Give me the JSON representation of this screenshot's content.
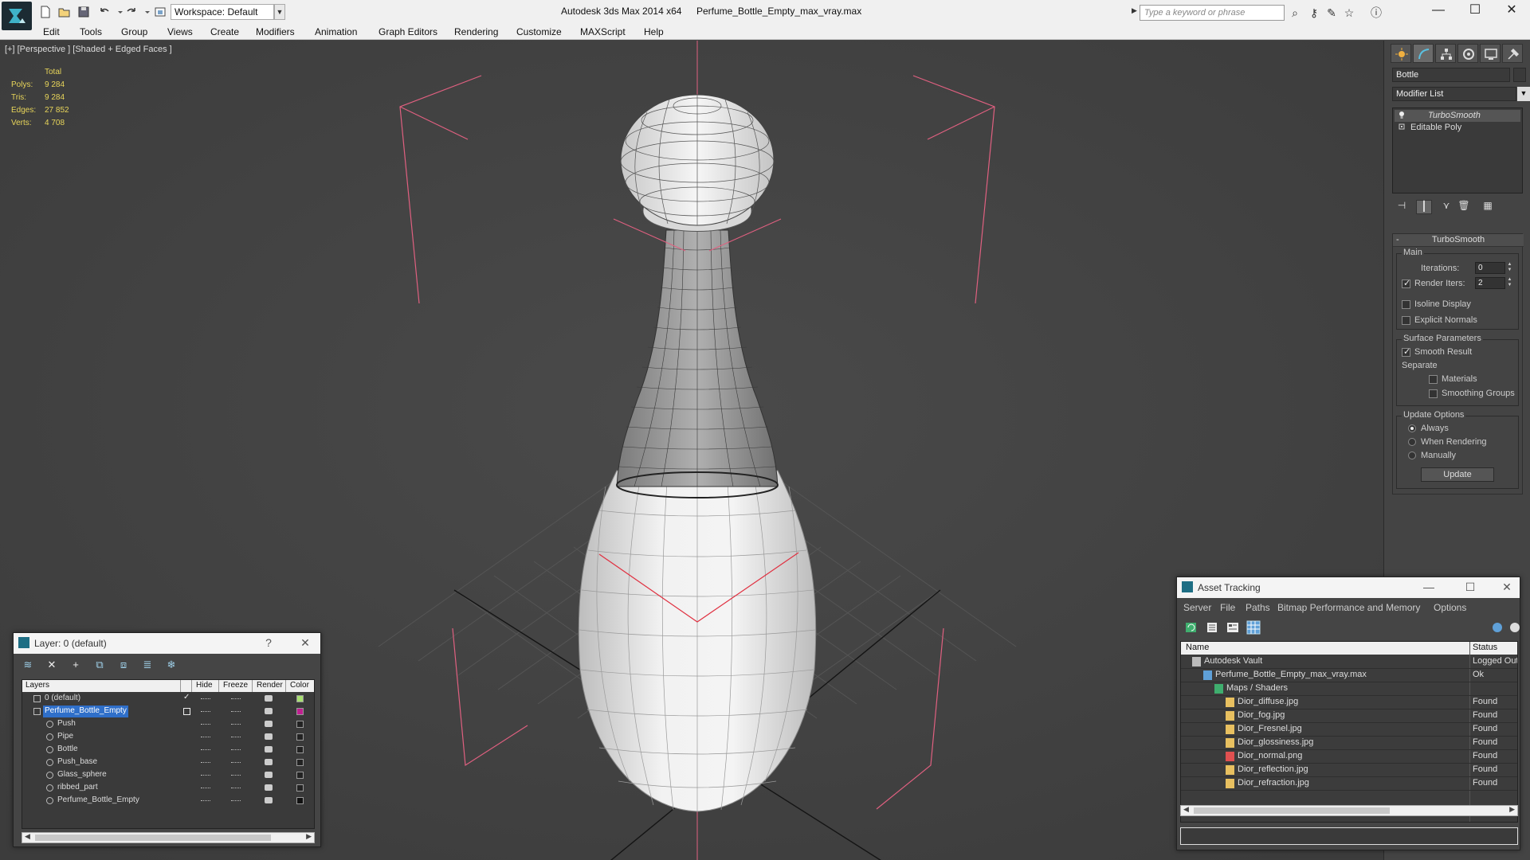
{
  "titlebar": {
    "workspace": "Workspace: Default",
    "app_title": "Autodesk 3ds Max 2014 x64",
    "file_title": "Perfume_Bottle_Empty_max_vray.max",
    "search_placeholder": "Type a keyword or phrase"
  },
  "menu": [
    "Edit",
    "Tools",
    "Group",
    "Views",
    "Create",
    "Modifiers",
    "Animation",
    "Graph Editors",
    "Rendering",
    "Customize",
    "MAXScript",
    "Help"
  ],
  "viewport": {
    "label": "[+] [Perspective ] [Shaded + Edged Faces ]",
    "stats": {
      "header": "Total",
      "rows": [
        {
          "label": "Polys:",
          "value": "9 284"
        },
        {
          "label": "Tris:",
          "value": "9 284"
        },
        {
          "label": "Edges:",
          "value": "27 852"
        },
        {
          "label": "Verts:",
          "value": "4 708"
        }
      ]
    }
  },
  "command_panel": {
    "object_name": "Bottle",
    "modifier_list": "Modifier List",
    "stack": [
      "TurboSmooth",
      "Editable Poly"
    ],
    "rollout_title": "TurboSmooth",
    "main_group": "Main",
    "iterations_label": "Iterations:",
    "iterations_value": "0",
    "render_iters_label": "Render Iters:",
    "render_iters_value": "2",
    "isoline_label": "Isoline Display",
    "explicit_normals_label": "Explicit Normals",
    "surface_group": "Surface Parameters",
    "smooth_result_label": "Smooth Result",
    "separate_label": "Separate",
    "materials_label": "Materials",
    "smoothing_groups_label": "Smoothing Groups",
    "update_group": "Update Options",
    "update_always": "Always",
    "update_when_rendering": "When Rendering",
    "update_manually": "Manually",
    "update_button": "Update"
  },
  "layer_window": {
    "title": "Layer: 0 (default)",
    "help": "?",
    "columns": [
      "Layers",
      "Hide",
      "Freeze",
      "Render",
      "Color"
    ],
    "rows": [
      {
        "name": "0 (default)",
        "indent": 0,
        "color": "#a8e070",
        "selected": false,
        "active": true
      },
      {
        "name": "Perfume_Bottle_Empty",
        "indent": 0,
        "color": "#c02090",
        "selected": true,
        "active": false
      },
      {
        "name": "Push",
        "indent": 1,
        "color": "#222222",
        "selected": false,
        "active": false
      },
      {
        "name": "Pipe",
        "indent": 1,
        "color": "#222222",
        "selected": false,
        "active": false
      },
      {
        "name": "Bottle",
        "indent": 1,
        "color": "#222222",
        "selected": false,
        "active": false
      },
      {
        "name": "Push_base",
        "indent": 1,
        "color": "#222222",
        "selected": false,
        "active": false
      },
      {
        "name": "Glass_sphere",
        "indent": 1,
        "color": "#222222",
        "selected": false,
        "active": false
      },
      {
        "name": "ribbed_part",
        "indent": 1,
        "color": "#222222",
        "selected": false,
        "active": false
      },
      {
        "name": "Perfume_Bottle_Empty",
        "indent": 1,
        "color": "#111111",
        "selected": false,
        "active": false
      }
    ]
  },
  "asset_window": {
    "title": "Asset Tracking",
    "menu": [
      "Server",
      "File",
      "Paths",
      "Bitmap Performance and Memory",
      "Options"
    ],
    "columns": [
      "Name",
      "Status"
    ],
    "rows": [
      {
        "name": "Autodesk Vault",
        "indent": 0,
        "status": "Logged Out",
        "icon": "vault"
      },
      {
        "name": "Perfume_Bottle_Empty_max_vray.max",
        "indent": 1,
        "status": "Ok",
        "icon": "max"
      },
      {
        "name": "Maps / Shaders",
        "indent": 2,
        "status": "",
        "icon": "maps"
      },
      {
        "name": "Dior_diffuse.jpg",
        "indent": 3,
        "status": "Found",
        "icon": "jpg"
      },
      {
        "name": "Dior_fog.jpg",
        "indent": 3,
        "status": "Found",
        "icon": "jpg"
      },
      {
        "name": "Dior_Fresnel.jpg",
        "indent": 3,
        "status": "Found",
        "icon": "jpg"
      },
      {
        "name": "Dior_glossiness.jpg",
        "indent": 3,
        "status": "Found",
        "icon": "jpg"
      },
      {
        "name": "Dior_normal.png",
        "indent": 3,
        "status": "Found",
        "icon": "png"
      },
      {
        "name": "Dior_reflection.jpg",
        "indent": 3,
        "status": "Found",
        "icon": "jpg"
      },
      {
        "name": "Dior_refraction.jpg",
        "indent": 3,
        "status": "Found",
        "icon": "jpg"
      }
    ]
  },
  "colors": {
    "selection": "#2f6fc9",
    "stats_yellow": "#e8d55a",
    "bracket_pink": "#e06080",
    "axis_red": "#e03040"
  }
}
